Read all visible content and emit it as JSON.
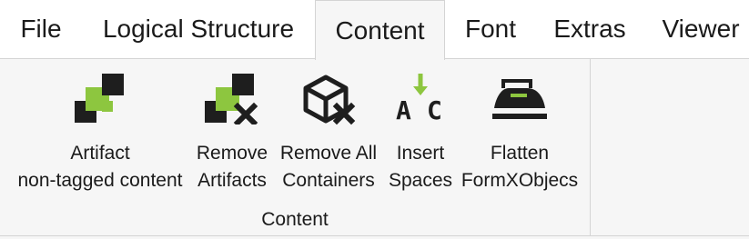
{
  "tabs": [
    {
      "label": "File"
    },
    {
      "label": "Logical Structure"
    },
    {
      "label": "Content"
    },
    {
      "label": "Font"
    },
    {
      "label": "Extras"
    },
    {
      "label": "Viewer"
    }
  ],
  "active_tab": "Content",
  "ribbon": {
    "group_label": "Content",
    "commands": [
      {
        "line1": "Artifact",
        "line2": "non-tagged content",
        "icon": "artifact-icon"
      },
      {
        "line1": "Remove",
        "line2": "Artifacts",
        "icon": "remove-artifacts-icon"
      },
      {
        "line1": "Remove All",
        "line2": "Containers",
        "icon": "remove-containers-icon"
      },
      {
        "line1": "Insert",
        "line2": "Spaces",
        "icon": "insert-spaces-icon"
      },
      {
        "line1": "Flatten",
        "line2": "FormXObjecs",
        "icon": "flatten-iron-icon"
      }
    ]
  },
  "colors": {
    "accent_green": "#8dc63f",
    "icon_dark": "#1e1e1e",
    "ribbon_bg": "#f6f6f6",
    "tabbar_bg": "#ffffff",
    "border": "#d4d4d4"
  }
}
